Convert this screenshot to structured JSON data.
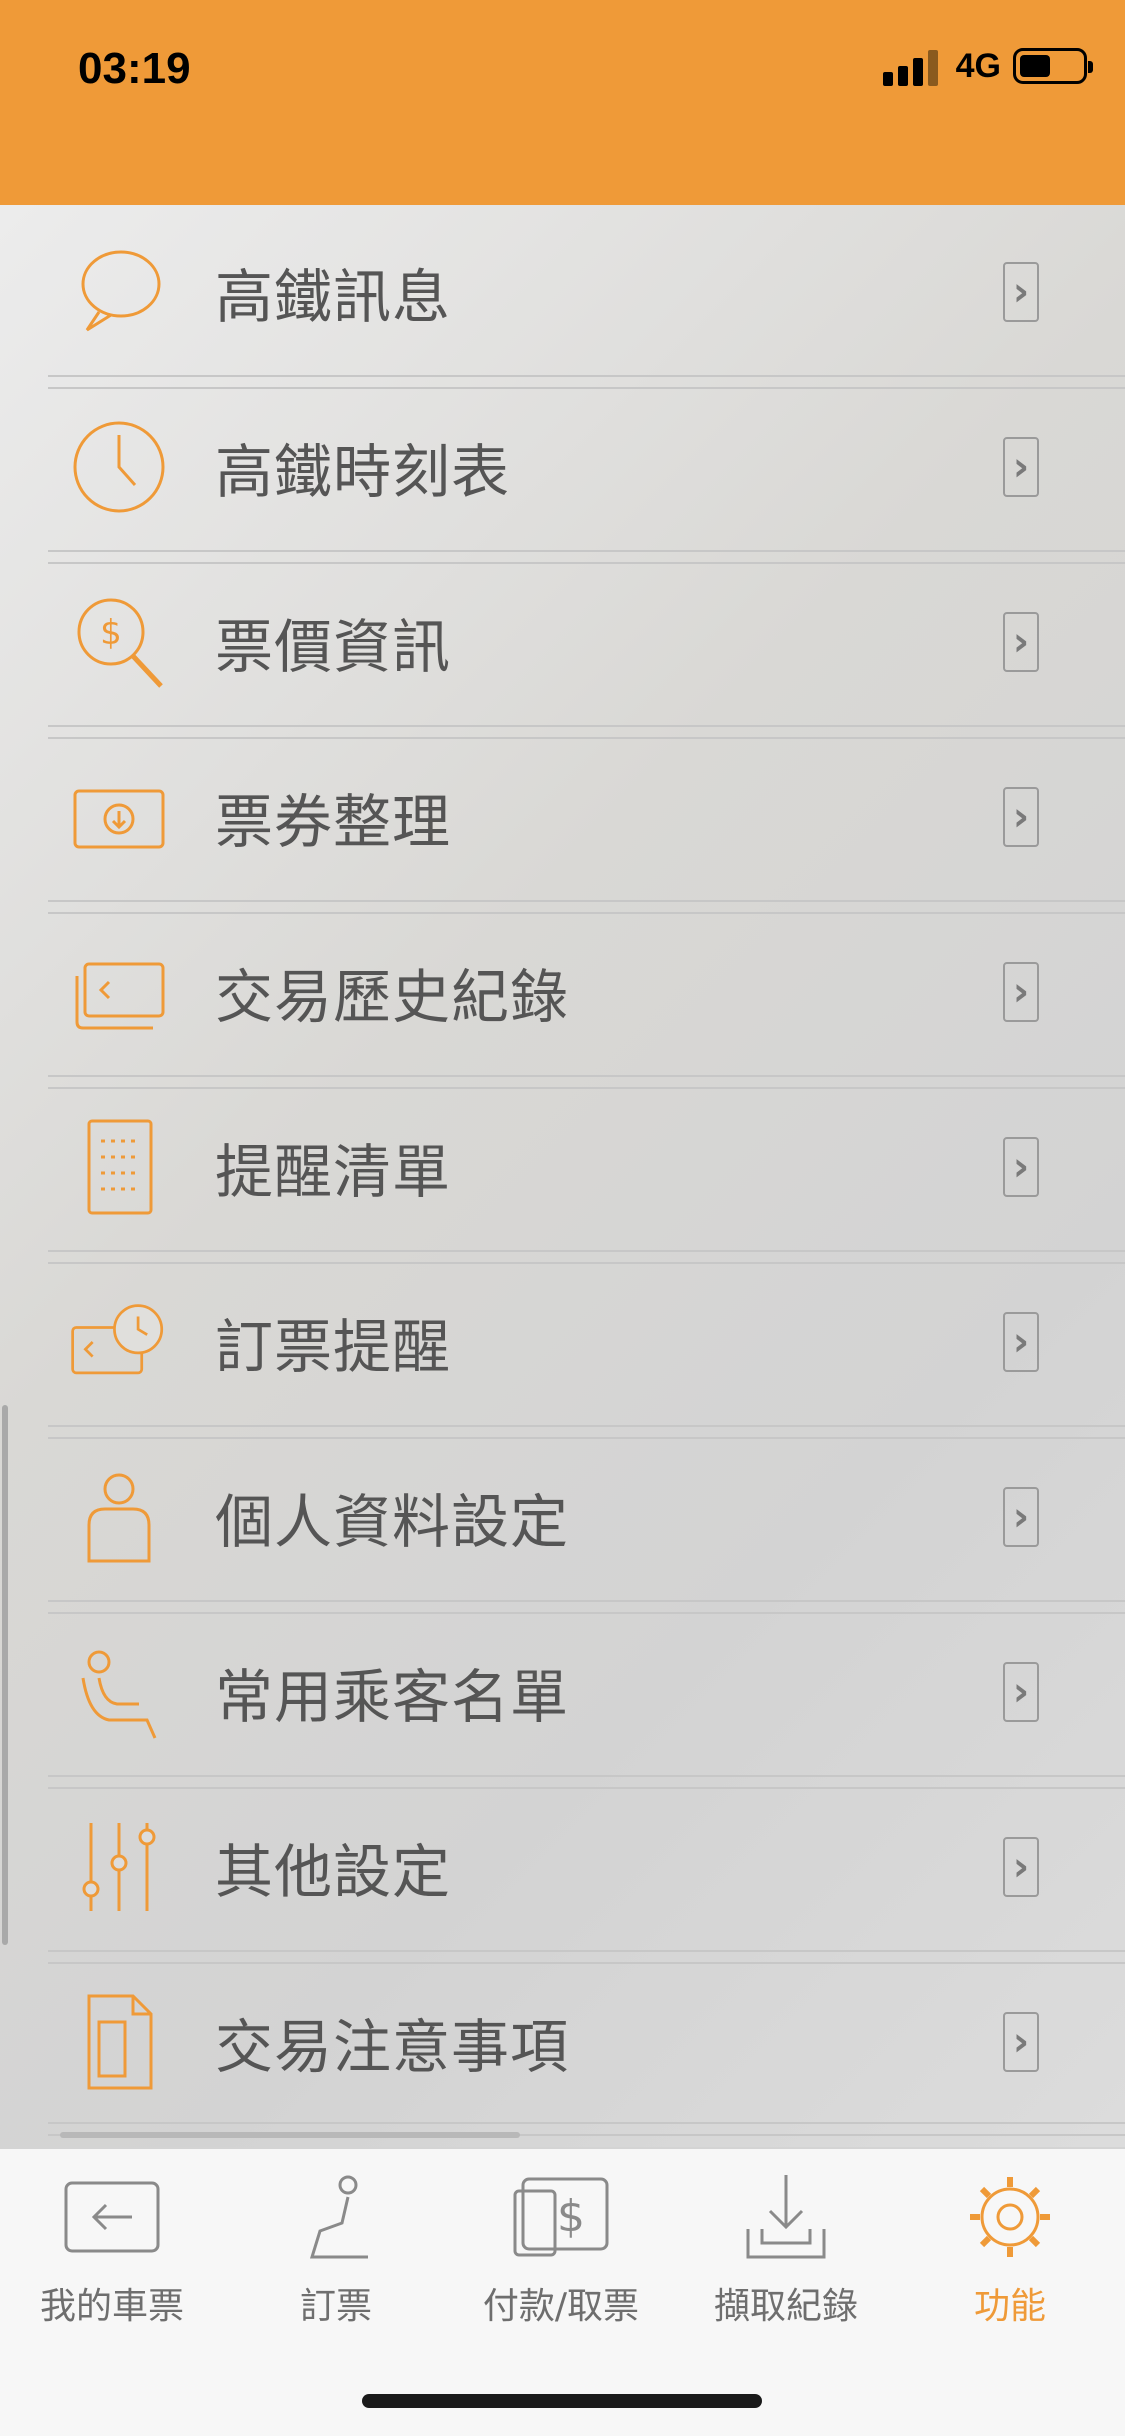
{
  "status_bar": {
    "time": "03:19",
    "network": "4G",
    "color": "#ef9a38",
    "signal_icon": "signal-bars-icon",
    "battery_icon": "battery-icon"
  },
  "menu": {
    "items": [
      {
        "label": "高鐵訊息",
        "icon": "speech-bubble-icon"
      },
      {
        "label": "高鐵時刻表",
        "icon": "clock-icon"
      },
      {
        "label": "票價資訊",
        "icon": "magnifier-dollar-icon"
      },
      {
        "label": "票券整理",
        "icon": "ticket-download-icon"
      },
      {
        "label": "交易歷史紀錄",
        "icon": "history-card-icon"
      },
      {
        "label": "提醒清單",
        "icon": "checklist-icon"
      },
      {
        "label": "訂票提醒",
        "icon": "booking-alarm-icon"
      },
      {
        "label": "個人資料設定",
        "icon": "person-icon"
      },
      {
        "label": "常用乘客名單",
        "icon": "passenger-seat-icon"
      },
      {
        "label": "其他設定",
        "icon": "sliders-icon"
      },
      {
        "label": "交易注意事項",
        "icon": "document-icon"
      }
    ]
  },
  "tab_bar": {
    "tabs": [
      {
        "label": "我的車票",
        "icon": "ticket-back-icon"
      },
      {
        "label": "訂票",
        "icon": "seat-icon"
      },
      {
        "label": "付款/取票",
        "icon": "payment-icon"
      },
      {
        "label": "擷取紀錄",
        "icon": "download-tray-icon"
      },
      {
        "label": "功能",
        "icon": "gear-icon"
      }
    ],
    "active_color": "#ef9a38",
    "inactive_color": "#6e6e6e"
  }
}
